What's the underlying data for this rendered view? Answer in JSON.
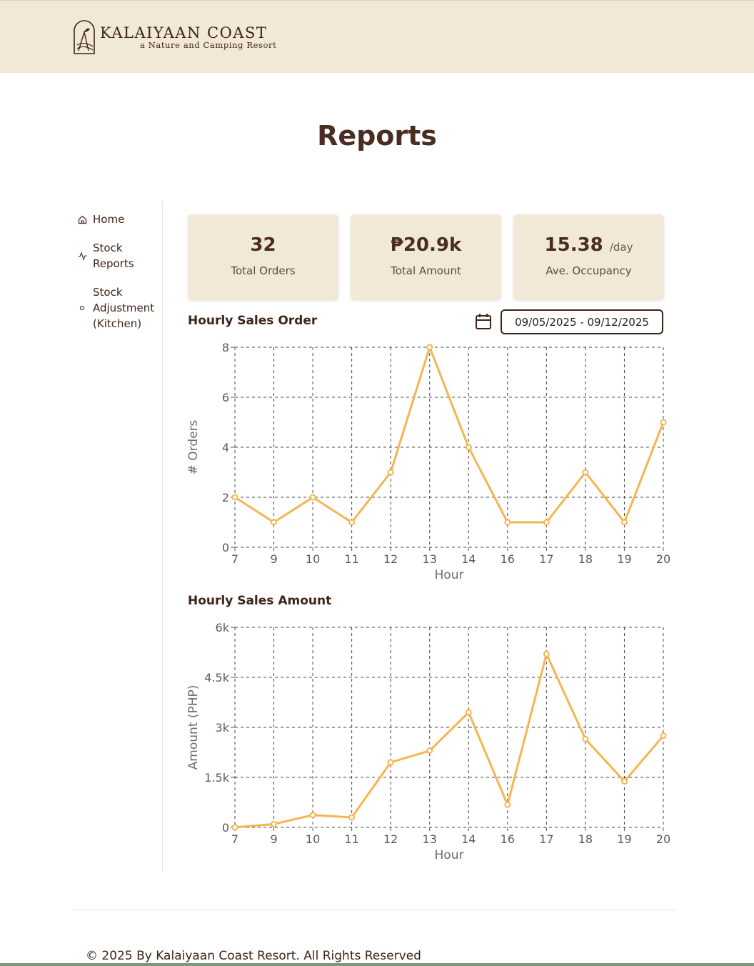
{
  "brand": {
    "name": "KALAIYAAN COAST",
    "tagline": "a Nature and Camping Resort"
  },
  "page": {
    "title": "Reports"
  },
  "sidebar": {
    "items": [
      {
        "label": "Home",
        "icon": "home-icon"
      },
      {
        "label": "Stock Reports",
        "icon": "activity-icon"
      },
      {
        "label": "Stock Adjustment (Kitchen)",
        "icon": "dot-icon"
      }
    ]
  },
  "kpis": {
    "total_orders": {
      "value": "32",
      "label": "Total Orders"
    },
    "total_amount": {
      "value": "₱20.9k",
      "label": "Total Amount"
    },
    "occupancy": {
      "value": "15.38",
      "unit": "/day",
      "label": "Ave. Occupancy"
    }
  },
  "filter": {
    "date_range": "09/05/2025 - 09/12/2025",
    "icon": "calendar-icon"
  },
  "colors": {
    "accent": "#f5b550",
    "panel": "#f2e8d8",
    "text": "#4a2c20"
  },
  "chart_data": [
    {
      "type": "line",
      "title": "Hourly Sales Order",
      "xlabel": "Hour",
      "ylabel": "# Orders",
      "categories": [
        "7",
        "9",
        "10",
        "11",
        "12",
        "13",
        "14",
        "16",
        "17",
        "18",
        "19",
        "20"
      ],
      "values": [
        2,
        1,
        2,
        1,
        3,
        8,
        4,
        1,
        1,
        3,
        1,
        5
      ],
      "yticks": [
        "0",
        "2",
        "4",
        "6",
        "8"
      ],
      "ylim": [
        0,
        8
      ],
      "grid": true
    },
    {
      "type": "line",
      "title": "Hourly Sales Amount",
      "xlabel": "Hour",
      "ylabel": "Amount (PHP)",
      "categories": [
        "7",
        "9",
        "10",
        "11",
        "12",
        "13",
        "14",
        "16",
        "17",
        "18",
        "19",
        "20"
      ],
      "values": [
        0,
        100,
        370,
        300,
        1950,
        2300,
        3450,
        680,
        5200,
        2650,
        1380,
        2750
      ],
      "yticks": [
        "0",
        "1.5k",
        "3k",
        "4.5k",
        "6k"
      ],
      "ylim": [
        0,
        6000
      ],
      "grid": true
    }
  ],
  "footer": {
    "text": "© 2025 By Kalaiyaan Coast Resort. All Rights Reserved"
  }
}
